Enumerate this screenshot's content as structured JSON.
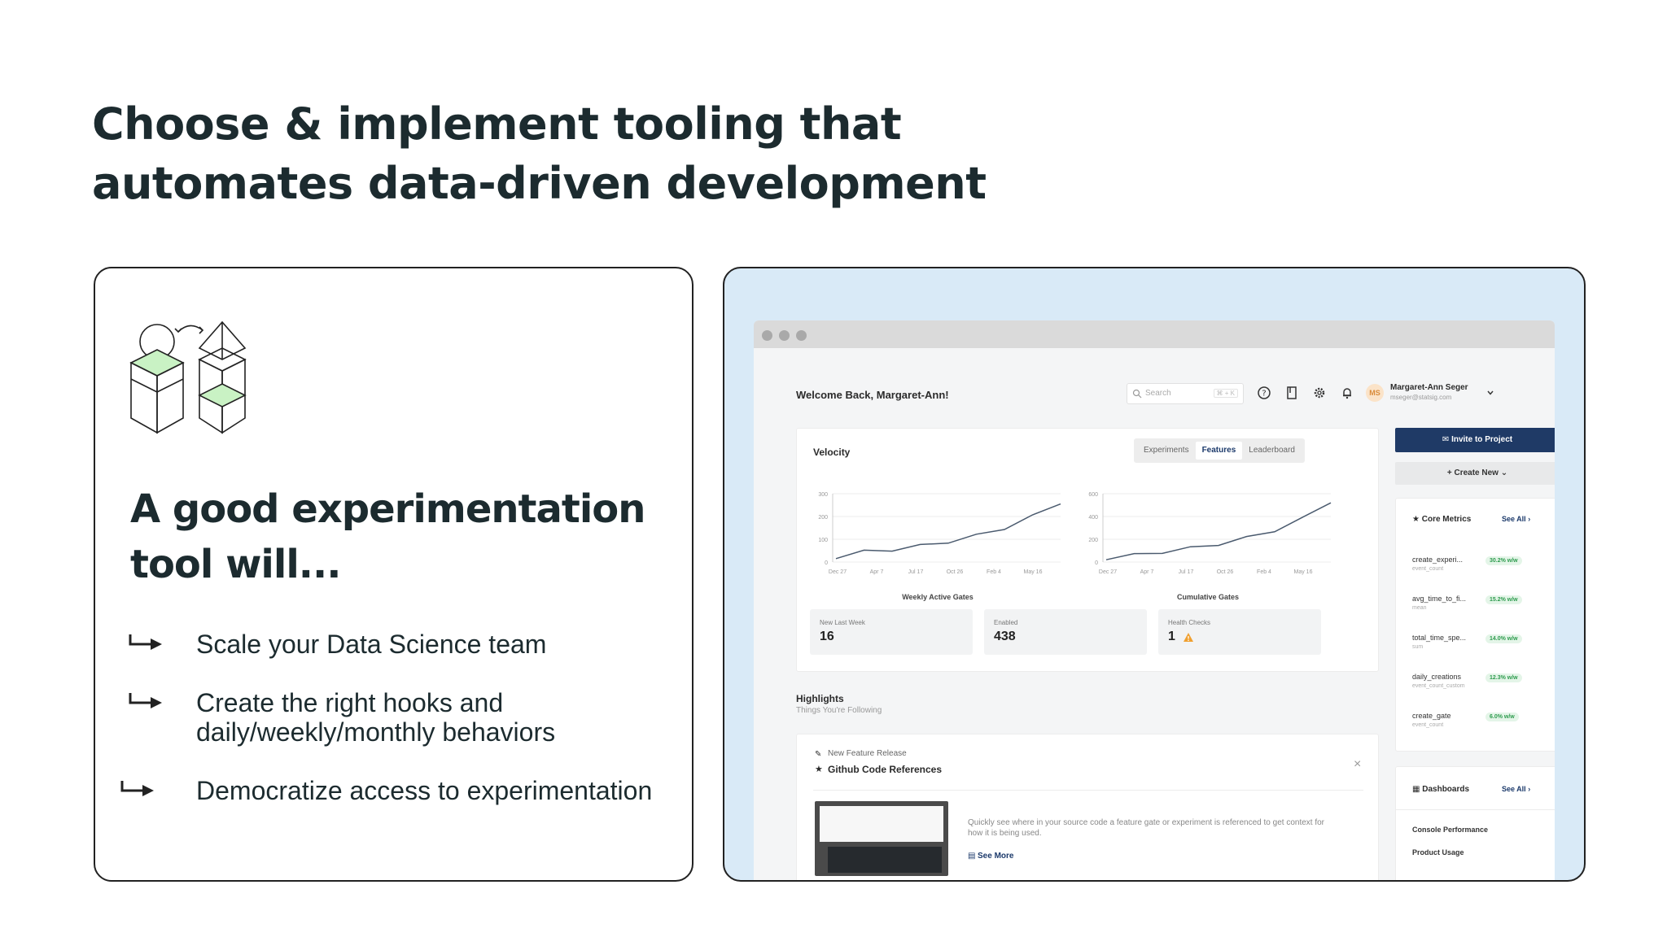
{
  "slide": {
    "title": "Choose & implement tooling that automates data-driven development",
    "card_heading": "A good experimentation tool will...",
    "bullets": [
      "Scale your Data Science team",
      "Create the right hooks and daily/weekly/monthly behaviors",
      "Democratize access to experimentation"
    ]
  },
  "app": {
    "welcome": "Welcome Back, Margaret-Ann!",
    "search_placeholder": "Search",
    "search_shortcut": "⌘ + K",
    "user": {
      "initials": "MS",
      "name": "Margaret-Ann Seger",
      "email": "mseger@statsig.com"
    },
    "velocity": {
      "title": "Velocity",
      "tabs": [
        "Experiments",
        "Features",
        "Leaderboard"
      ],
      "active_tab": "Features"
    },
    "stats": [
      {
        "label": "New Last Week",
        "value": "16"
      },
      {
        "label": "Enabled",
        "value": "438"
      },
      {
        "label": "Health Checks",
        "value": "1"
      }
    ],
    "highlights": {
      "title": "Highlights",
      "subtitle": "Things You're Following",
      "release_tag": "New Feature Release",
      "release_title": "Github Code References",
      "release_desc": "Quickly see where in your source code a feature gate or experiment is referenced to get context for how it is being used.",
      "see_more": "See More"
    },
    "invite_label": "Invite to Project",
    "create_new_label": "Create New",
    "core_metrics": {
      "title": "Core Metrics",
      "see_all": "See All",
      "items": [
        {
          "name": "create_experi...",
          "sub": "event_count",
          "badge": "30.2% w/w"
        },
        {
          "name": "avg_time_to_fi...",
          "sub": "mean",
          "badge": "15.2% w/w"
        },
        {
          "name": "total_time_spe...",
          "sub": "sum",
          "badge": "14.0% w/w"
        },
        {
          "name": "daily_creations",
          "sub": "event_count_custom",
          "badge": "12.3% w/w"
        },
        {
          "name": "create_gate",
          "sub": "event_count",
          "badge": "6.0% w/w"
        }
      ]
    },
    "dashboards": {
      "title": "Dashboards",
      "see_all": "See All",
      "items": [
        "Console Performance",
        "Product Usage"
      ]
    }
  },
  "chart_data": [
    {
      "type": "line",
      "title": "Weekly Active Gates",
      "x": [
        "Dec 27",
        "Apr 7",
        "Jul 17",
        "Oct 26",
        "Feb 4",
        "May 16"
      ],
      "y_ticks": [
        0,
        100,
        200,
        300
      ],
      "ylim": [
        0,
        300
      ],
      "values": [
        15,
        45,
        55,
        70,
        90,
        115,
        150,
        200,
        255
      ]
    },
    {
      "type": "line",
      "title": "Cumulative Gates",
      "x": [
        "Dec 27",
        "Apr 7",
        "Jul 17",
        "Oct 26",
        "Feb 4",
        "May 16"
      ],
      "y_ticks": [
        0,
        200,
        400,
        600
      ],
      "ylim": [
        0,
        600
      ],
      "values": [
        20,
        60,
        90,
        120,
        160,
        210,
        280,
        380,
        520
      ]
    }
  ]
}
